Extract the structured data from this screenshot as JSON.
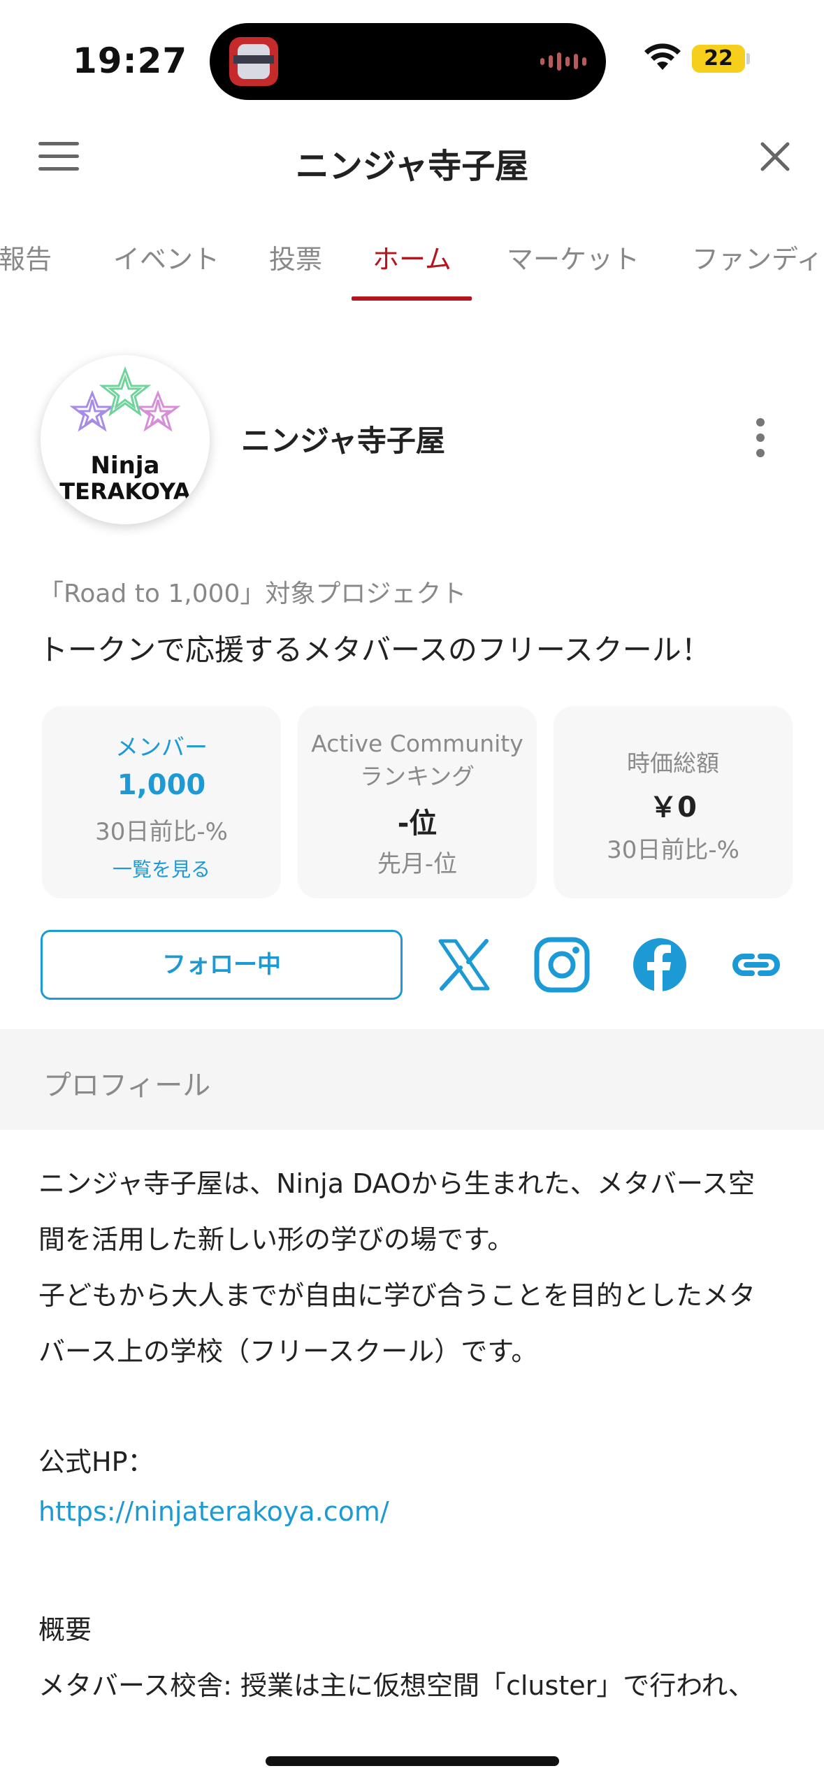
{
  "status_bar": {
    "time": "19:27",
    "battery": "22",
    "icons": [
      "app-icon",
      "audio-wave-icon",
      "wifi-icon",
      "battery-icon"
    ]
  },
  "header": {
    "title": "ニンジャ寺子屋",
    "menu_icon": "hamburger-menu-icon",
    "close_icon": "close-icon"
  },
  "tabs": [
    {
      "label": "活動報告",
      "active": false
    },
    {
      "label": "イベント",
      "active": false
    },
    {
      "label": "投票",
      "active": false
    },
    {
      "label": "ホーム",
      "active": true
    },
    {
      "label": "マーケット",
      "active": false
    },
    {
      "label": "ファンディング",
      "active": false
    }
  ],
  "profile": {
    "logo": {
      "line1": "Ninja",
      "line2": "TERAKOYA"
    },
    "name": "ニンジャ寺子屋",
    "tagline": "「Road to 1,000」対象プロジェクト",
    "description": "トークンで応援するメタバースのフリースクール！"
  },
  "stats": {
    "members": {
      "label": "メンバー",
      "value": "1,000",
      "sub": "30日前比-%",
      "link": "一覧を見る"
    },
    "ranking": {
      "label_line1": "Active Community",
      "label_line2": "ランキング",
      "value": "-位",
      "sub": "先月-位"
    },
    "market_cap": {
      "label": "時価総額",
      "value": "￥0",
      "sub": "30日前比-%"
    }
  },
  "actions": {
    "follow_label": "フォロー中",
    "social": [
      "x-icon",
      "instagram-icon",
      "facebook-icon",
      "link-icon"
    ]
  },
  "section": {
    "title": "プロフィール"
  },
  "body": {
    "line1": "ニンジャ寺子屋は、Ninja DAOから生まれた、メタバース空",
    "line2": "間を活用した新しい形の学びの場です。",
    "line3": "子どもから大人までが自由に学び合うことを目的としたメタ",
    "line4": "バース上の学校（フリースクール）です。",
    "hp_label": "公式HP：",
    "hp_url": "https://ninjaterakoya.com/",
    "overview_label": "概要",
    "overview_line": "メタバース校舎: 授業は主に仮想空間「cluster」で行われ、"
  },
  "colors": {
    "accent_red": "#b5161e",
    "accent_blue": "#1b9ad6",
    "battery_yellow": "#f5cf1b"
  }
}
